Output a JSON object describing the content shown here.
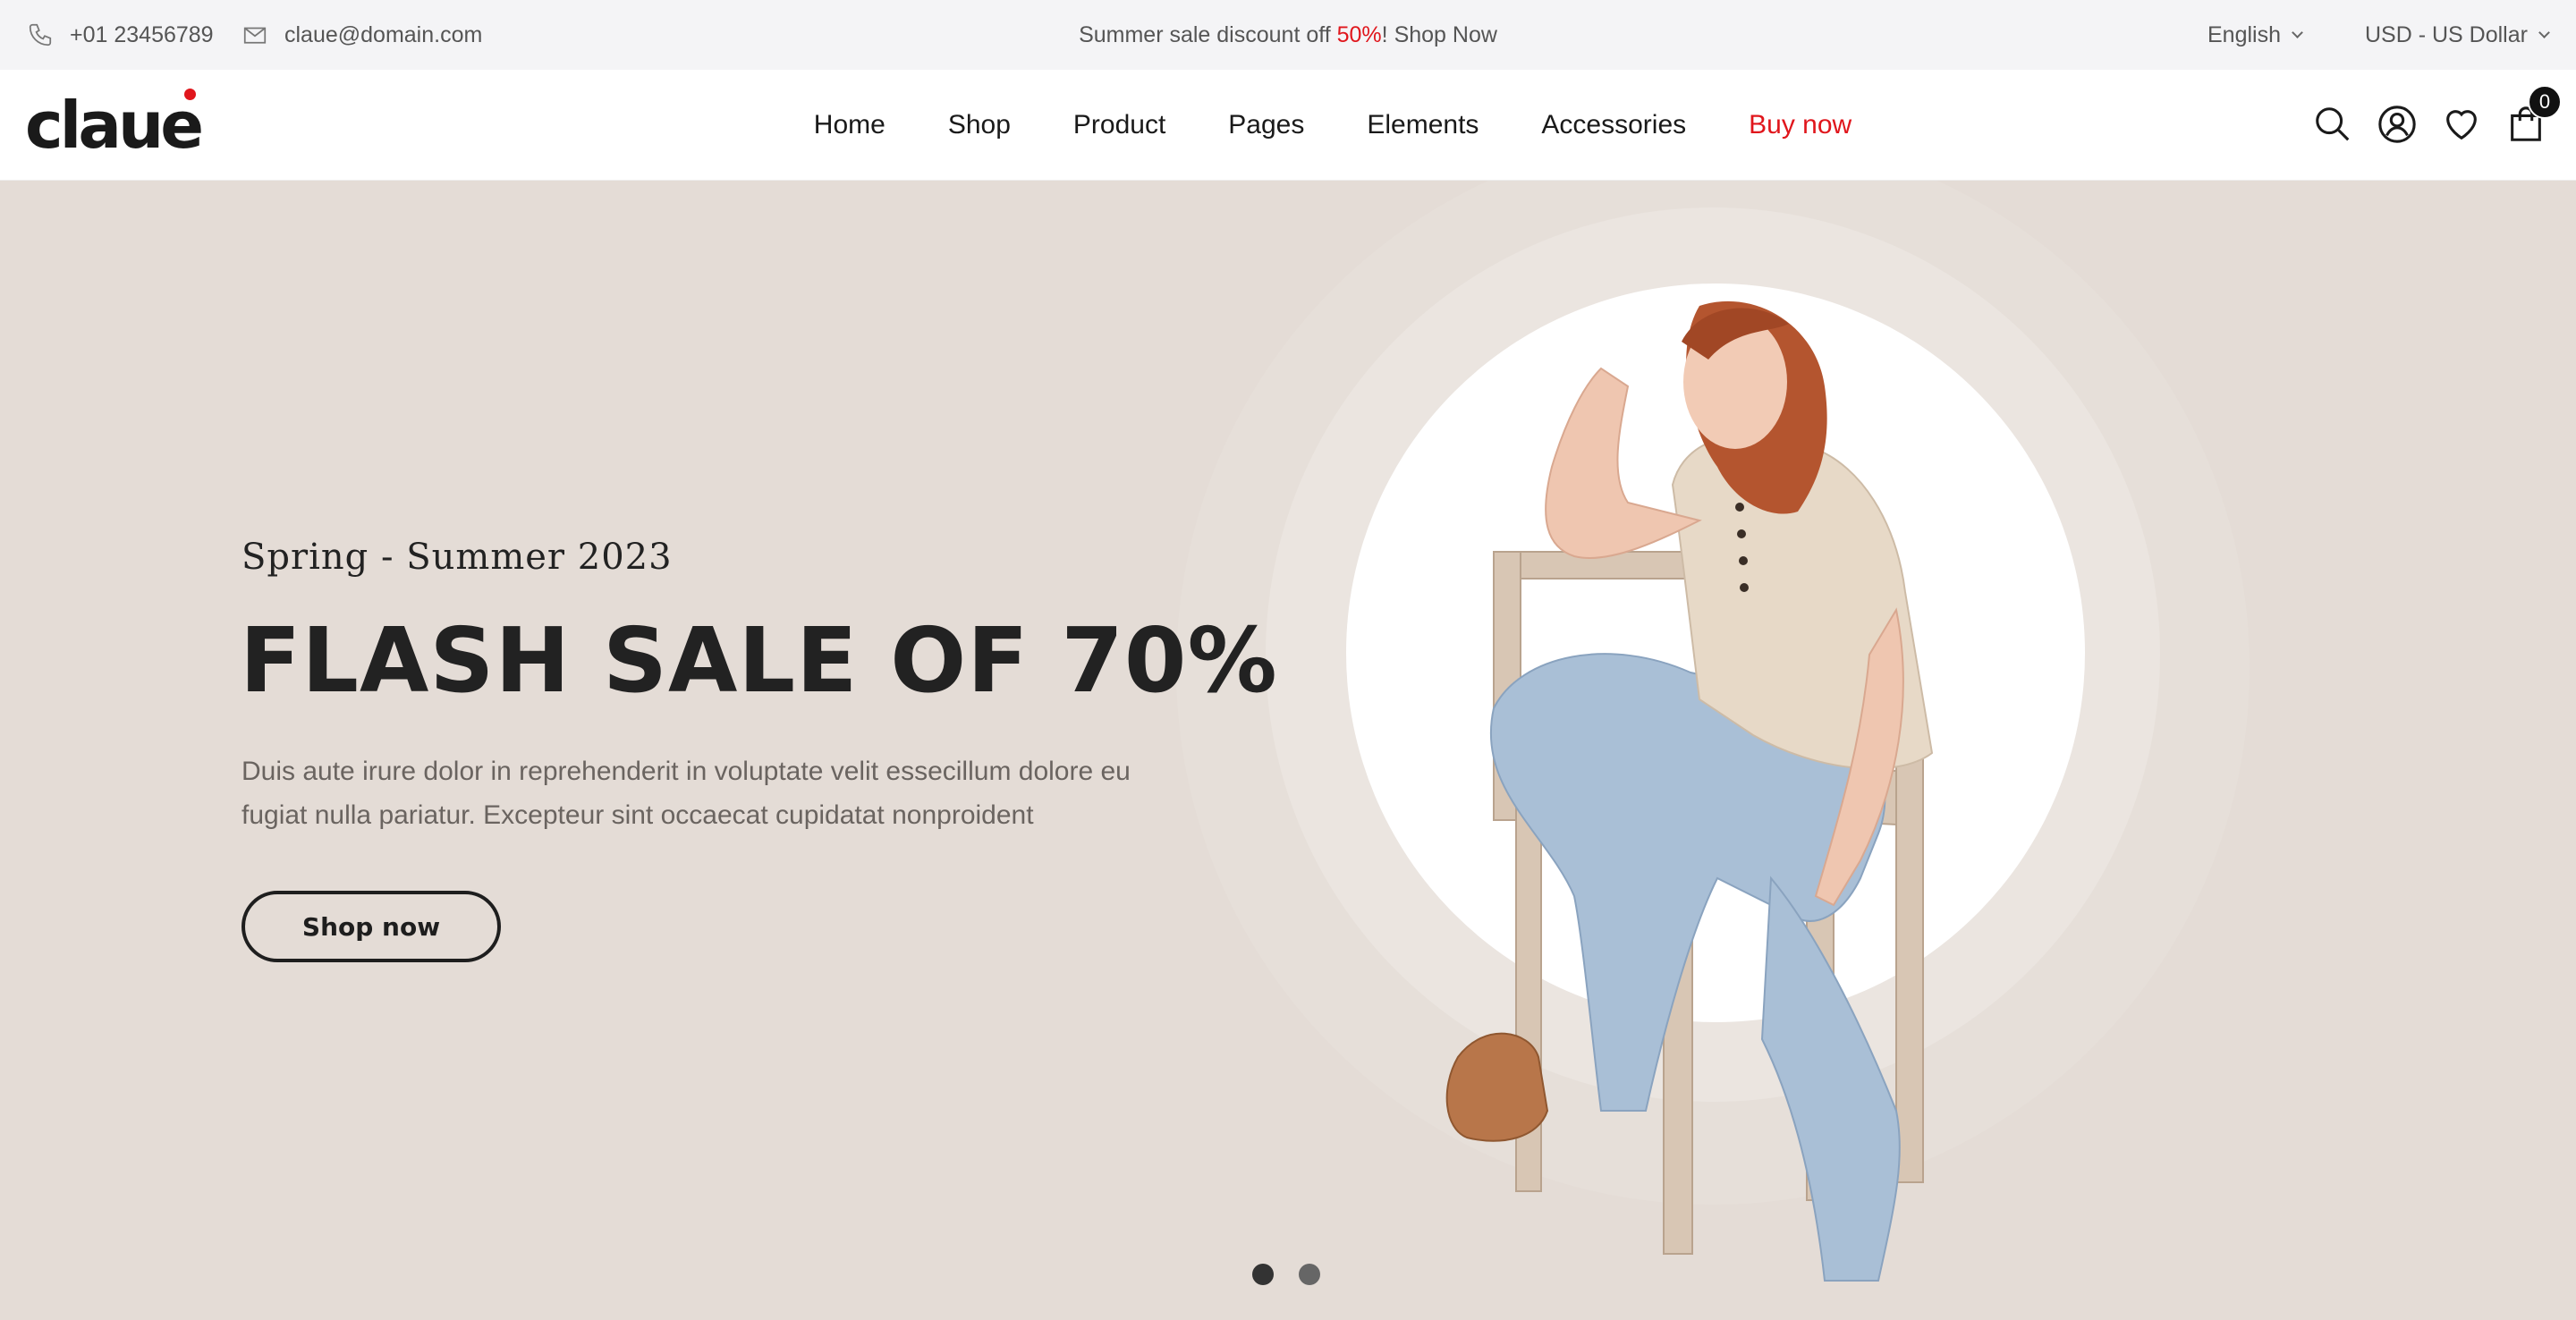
{
  "topbar": {
    "phone": "+01 23456789",
    "email": "claue@domain.com",
    "promo_before": "Summer sale discount off ",
    "promo_highlight": "50%",
    "promo_after": "! Shop Now",
    "language": "English",
    "currency": "USD - US Dollar"
  },
  "header": {
    "logo": "claue",
    "nav": [
      "Home",
      "Shop",
      "Product",
      "Pages",
      "Elements",
      "Accessories",
      "Buy now"
    ],
    "cart_count": "0"
  },
  "hero": {
    "subtitle": "Spring - Summer 2023",
    "title": "FLASH SALE OF 70%",
    "description_line1": "Duis aute irure dolor in reprehenderit in voluptate velit essecillum dolore eu",
    "description_line2": "fugiat nulla pariatur. Excepteur sint occaecat cupidatat nonproident",
    "button": "Shop now",
    "slides": 2,
    "active_slide": 1
  },
  "colors": {
    "accent": "#e0161c",
    "hero_bg": "#e4dcd6",
    "topbar_bg": "#f4f4f6",
    "text_dark": "#222222"
  },
  "icons": [
    "phone-icon",
    "mail-icon",
    "chevron-down-icon",
    "search-icon",
    "user-icon",
    "heart-icon",
    "cart-icon"
  ]
}
